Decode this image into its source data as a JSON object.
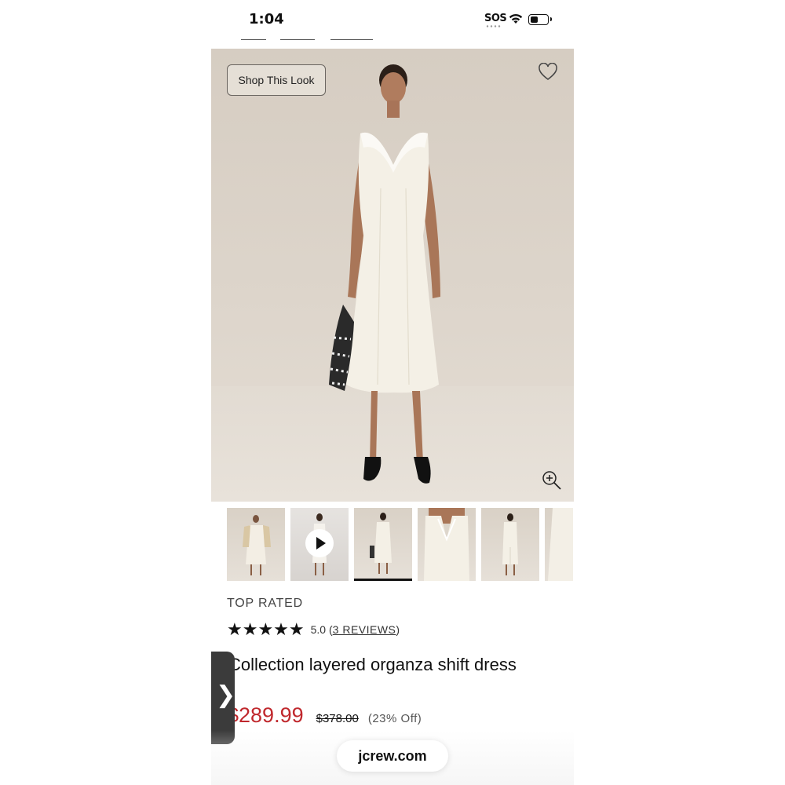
{
  "status_bar": {
    "time": "1:04",
    "sos": "SOS",
    "battery_level": 0.35,
    "icons": [
      "wifi-icon",
      "battery-icon"
    ]
  },
  "product_image": {
    "shop_look_label": "Shop This Look",
    "icons": [
      "heart-icon",
      "zoom-in-icon"
    ]
  },
  "thumbnails": {
    "count_visible": 6,
    "active_index": 2,
    "video_index": 1,
    "icons": [
      "play-icon"
    ]
  },
  "product": {
    "badge": "TOP RATED",
    "stars": "★★★★★",
    "rating": "5.0",
    "reviews_open": "(",
    "reviews_link": "3 REVIEWS",
    "reviews_close": ")",
    "title": "Collection layered organza shift dress",
    "sale_price": "$289.99",
    "original_price": "$378.00",
    "discount": "(23% Off)"
  },
  "side_tab": {
    "glyph": "❯"
  },
  "browser": {
    "url": "jcrew.com"
  },
  "colors": {
    "sale_price": "#c0282d",
    "background": "#ffffff",
    "image_backdrop": "#d8d0c5"
  }
}
